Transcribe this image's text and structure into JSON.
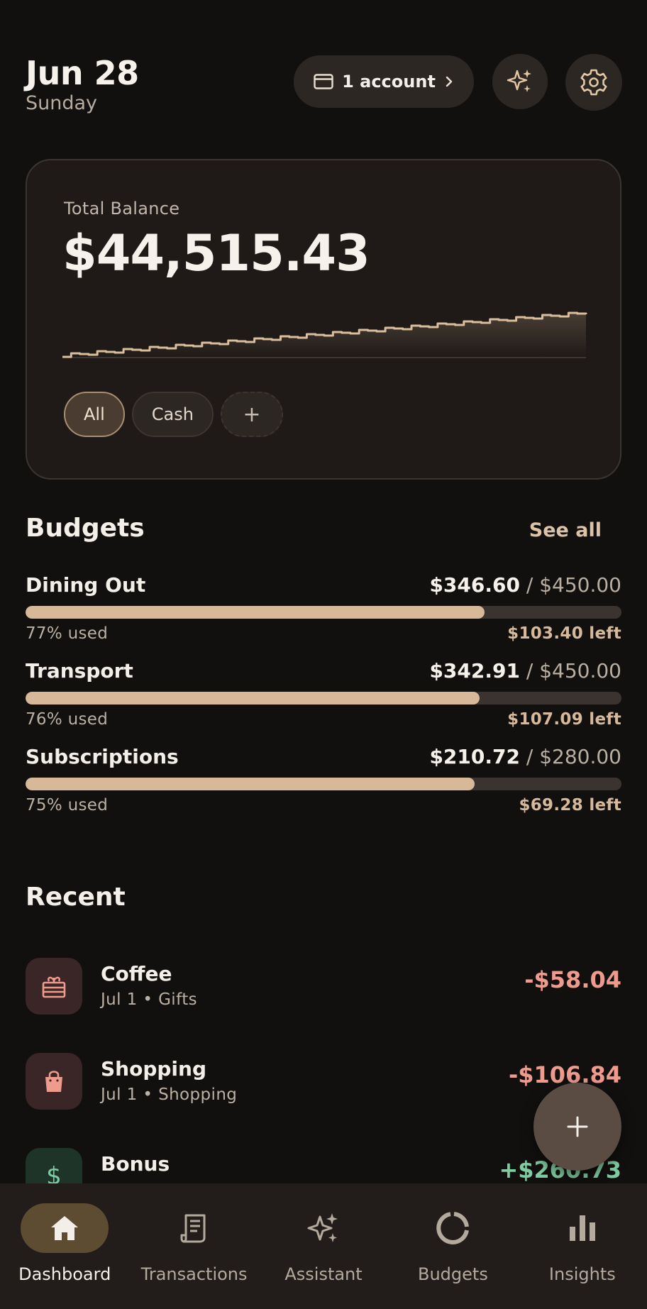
{
  "header": {
    "date": "Jun 28",
    "weekday": "Sunday",
    "account_pill": "1 account"
  },
  "balance": {
    "label": "Total Balance",
    "amount": "$44,515.43",
    "chips": [
      "All",
      "Cash",
      "+"
    ]
  },
  "budgets": {
    "title": "Budgets",
    "see_all": "See all",
    "items": [
      {
        "name": "Dining Out",
        "spent": "$346.60",
        "limit": "/ $450.00",
        "used": "77% used",
        "left": "$103.40 left",
        "fraction": 0.77
      },
      {
        "name": "Transport",
        "spent": "$342.91",
        "limit": "/ $450.00",
        "used": "76% used",
        "left": "$107.09 left",
        "fraction": 0.762
      },
      {
        "name": "Subscriptions",
        "spent": "$210.72",
        "limit": "/ $280.00",
        "used": "75% used",
        "left": "$69.28 left",
        "fraction": 0.753
      }
    ]
  },
  "recent": {
    "title": "Recent",
    "items": [
      {
        "name": "Coffee",
        "sub": "Jul 1 • Gifts",
        "amount": "-$58.04",
        "kind": "negative",
        "icon": "gift-icon"
      },
      {
        "name": "Shopping",
        "sub": "Jul 1 • Shopping",
        "amount": "-$106.84",
        "kind": "negative",
        "icon": "shopping-bag-icon"
      },
      {
        "name": "Bonus",
        "sub": "",
        "amount": "+$260.73",
        "kind": "positive",
        "icon": "dollar-icon"
      }
    ]
  },
  "nav": {
    "items": [
      {
        "label": "Dashboard",
        "icon": "home-icon",
        "active": true
      },
      {
        "label": "Transactions",
        "icon": "receipt-icon",
        "active": false
      },
      {
        "label": "Assistant",
        "icon": "sparkle-icon",
        "active": false
      },
      {
        "label": "Budgets",
        "icon": "donut-icon",
        "active": false
      },
      {
        "label": "Insights",
        "icon": "bar-chart-icon",
        "active": false
      }
    ]
  },
  "colors": {
    "background": "#12100e",
    "card": "#1f1a18",
    "accent": "#d7b898",
    "negative": "#ee9b8e",
    "positive": "#7fcca2",
    "nav_active": "#5d4c31"
  }
}
